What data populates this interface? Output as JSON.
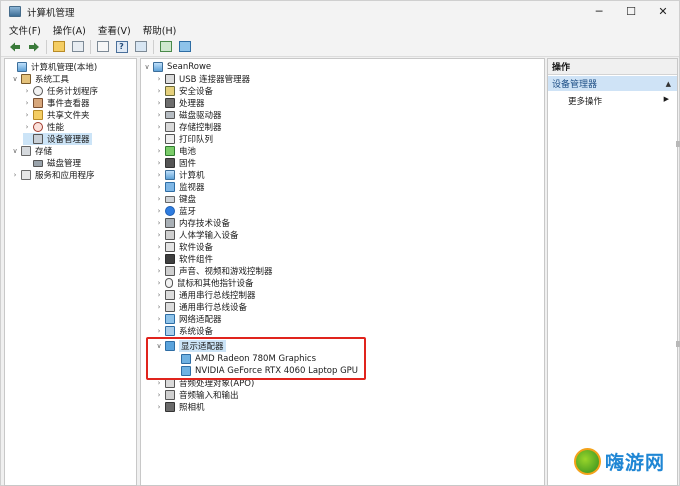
{
  "window": {
    "title": "计算机管理",
    "controls": {
      "minimize": "─",
      "maximize": "☐",
      "close": "✕"
    }
  },
  "menu": [
    "文件(F)",
    "操作(A)",
    "查看(V)",
    "帮助(H)"
  ],
  "toolbar": {
    "icons": [
      "back-icon",
      "forward-icon",
      "up-folder-icon",
      "show-tree-icon",
      "export-list-icon",
      "help-icon",
      "properties-icon",
      "action-icon",
      "monitor-icon"
    ],
    "help_glyph": "?"
  },
  "left_tree": [
    {
      "label": "计算机管理(本地)",
      "level": 0,
      "arrow": "",
      "icon": "computer-icon"
    },
    {
      "label": "系统工具",
      "level": 1,
      "arrow": "∨",
      "icon": "tools-icon"
    },
    {
      "label": "任务计划程序",
      "level": 2,
      "arrow": "›",
      "icon": "clock-icon"
    },
    {
      "label": "事件查看器",
      "level": 2,
      "arrow": "›",
      "icon": "event-log-icon"
    },
    {
      "label": "共享文件夹",
      "level": 2,
      "arrow": "›",
      "icon": "shared-folder-icon"
    },
    {
      "label": "性能",
      "level": 2,
      "arrow": "›",
      "icon": "performance-icon"
    },
    {
      "label": "设备管理器",
      "level": 2,
      "arrow": "",
      "icon": "device-manager-icon",
      "selected": true
    },
    {
      "label": "存储",
      "level": 1,
      "arrow": "∨",
      "icon": "storage-icon"
    },
    {
      "label": "磁盘管理",
      "level": 2,
      "arrow": "",
      "icon": "disk-icon"
    },
    {
      "label": "服务和应用程序",
      "level": 1,
      "arrow": "›",
      "icon": "services-icon"
    }
  ],
  "device_tree": {
    "root": {
      "label": "SeanRowe",
      "arrow": "∨"
    },
    "categories": [
      {
        "label": "USB 连接器管理器",
        "arrow": "›",
        "icon": "usb-icon"
      },
      {
        "label": "安全设备",
        "arrow": "›",
        "icon": "security-device-icon"
      },
      {
        "label": "处理器",
        "arrow": "›",
        "icon": "processor-icon"
      },
      {
        "label": "磁盘驱动器",
        "arrow": "›",
        "icon": "disk-drive-icon"
      },
      {
        "label": "存储控制器",
        "arrow": "›",
        "icon": "storage-controller-icon"
      },
      {
        "label": "打印队列",
        "arrow": "›",
        "icon": "print-queue-icon"
      },
      {
        "label": "电池",
        "arrow": "›",
        "icon": "battery-icon"
      },
      {
        "label": "固件",
        "arrow": "›",
        "icon": "firmware-icon"
      },
      {
        "label": "计算机",
        "arrow": "›",
        "icon": "computer-icon"
      },
      {
        "label": "监视器",
        "arrow": "›",
        "icon": "monitor-icon"
      },
      {
        "label": "键盘",
        "arrow": "›",
        "icon": "keyboard-icon"
      },
      {
        "label": "蓝牙",
        "arrow": "›",
        "icon": "bluetooth-icon"
      },
      {
        "label": "内存技术设备",
        "arrow": "›",
        "icon": "memory-device-icon"
      },
      {
        "label": "人体学输入设备",
        "arrow": "›",
        "icon": "hid-icon"
      },
      {
        "label": "软件设备",
        "arrow": "›",
        "icon": "software-device-icon"
      },
      {
        "label": "软件组件",
        "arrow": "›",
        "icon": "software-component-icon"
      },
      {
        "label": "声音、视频和游戏控制器",
        "arrow": "›",
        "icon": "audio-video-icon"
      },
      {
        "label": "鼠标和其他指针设备",
        "arrow": "›",
        "icon": "mouse-icon"
      },
      {
        "label": "通用串行总线控制器",
        "arrow": "›",
        "icon": "usb-controller-icon"
      },
      {
        "label": "通用串行总线设备",
        "arrow": "›",
        "icon": "usb-device-icon"
      },
      {
        "label": "网络适配器",
        "arrow": "›",
        "icon": "network-adapter-icon"
      },
      {
        "label": "系统设备",
        "arrow": "›",
        "icon": "system-device-icon"
      },
      {
        "label": "显示适配器",
        "arrow": "∨",
        "icon": "display-adapter-icon",
        "selected": true,
        "children": [
          {
            "label": "AMD Radeon 780M Graphics",
            "icon": "gpu-icon"
          },
          {
            "label": "NVIDIA GeForce RTX 4060 Laptop GPU",
            "icon": "gpu-icon"
          }
        ]
      },
      {
        "label": "音频处理对象(APO)",
        "arrow": "›",
        "icon": "audio-processing-icon"
      },
      {
        "label": "音频输入和输出",
        "arrow": "›",
        "icon": "audio-io-icon"
      },
      {
        "label": "照相机",
        "arrow": "›",
        "icon": "camera-icon"
      }
    ]
  },
  "actions": {
    "header": "操作",
    "section": "设备管理器",
    "section_arrow": "▲",
    "more": "更多操作",
    "more_arrow": "▶"
  },
  "watermark": {
    "text": "嗨游网"
  },
  "colors": {
    "highlight_box": "#e0241d",
    "selection": "#cce4f7",
    "watermark_text": "#1f86d4"
  }
}
